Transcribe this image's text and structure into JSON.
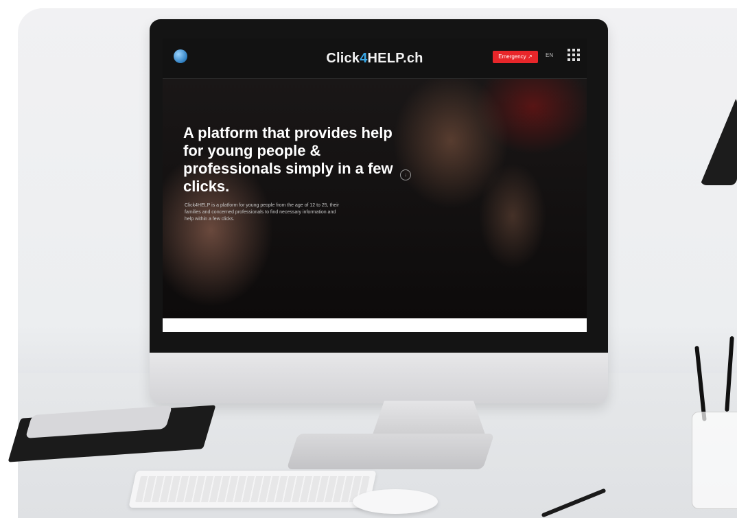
{
  "site": {
    "brand_prefix": "Click",
    "brand_accent": "4",
    "brand_suffix": "HELP.ch",
    "cta_label": "Emergency ↗",
    "language": "EN",
    "menu_icon": "grid-menu-icon",
    "hero_title": "A platform that provides help for young people & professionals simply in a few clicks.",
    "hero_text": "Click4HELP is a platform for young people from the age of 12 to 25, their families and concerned professionals to find necessary information and help within a few clicks.",
    "scroll_icon": "arrow-down-icon"
  },
  "colors": {
    "accent": "#39a7e6",
    "cta": "#e8262a"
  }
}
